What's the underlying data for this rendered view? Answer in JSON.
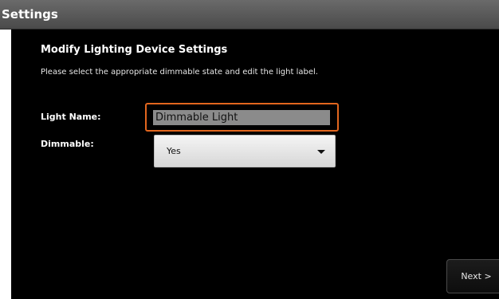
{
  "window": {
    "title": "Settings"
  },
  "form": {
    "heading": "Modify Lighting Device Settings",
    "description": "Please select the appropriate dimmable state and edit the light label.",
    "light_name_label": "Light Name:",
    "light_name_value": "Dimmable Light",
    "dimmable_label": "Dimmable:",
    "dimmable_selected": "Yes"
  },
  "actions": {
    "next_label": "Next >"
  },
  "colors": {
    "focus_border": "#e2661e",
    "background": "#000000",
    "title_bar": "#5a5a5a"
  }
}
